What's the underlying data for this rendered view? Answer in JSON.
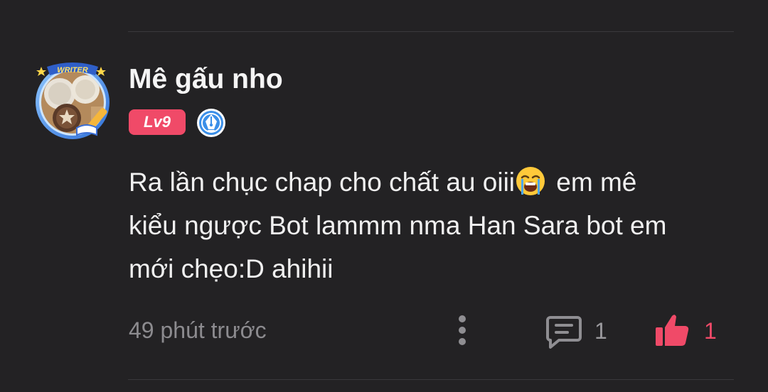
{
  "comment": {
    "author": {
      "name": "Mê gấu nho",
      "avatar_frame_label": "WRITER",
      "level": "Lv9",
      "writer_badge_icon": "fountain-pen-icon"
    },
    "text": {
      "line1_part1": "Ra lần chục chap cho chất au oiii",
      "emoji": "loudly-crying-face-icon",
      "line1_part2": " em mê",
      "line2": "kiểu ngược Bot lammm nma Han Sara bot em",
      "line3": "mới chẹo:D ahihii"
    },
    "timestamp": "49 phút trước",
    "reply_count": "1",
    "like_count": "1"
  },
  "colors": {
    "background": "#232224",
    "level_badge": "#f04a68",
    "like_active": "#f04a68",
    "muted_text": "#8c8b8f",
    "writer_badge_blue": "#3b8fe8"
  }
}
